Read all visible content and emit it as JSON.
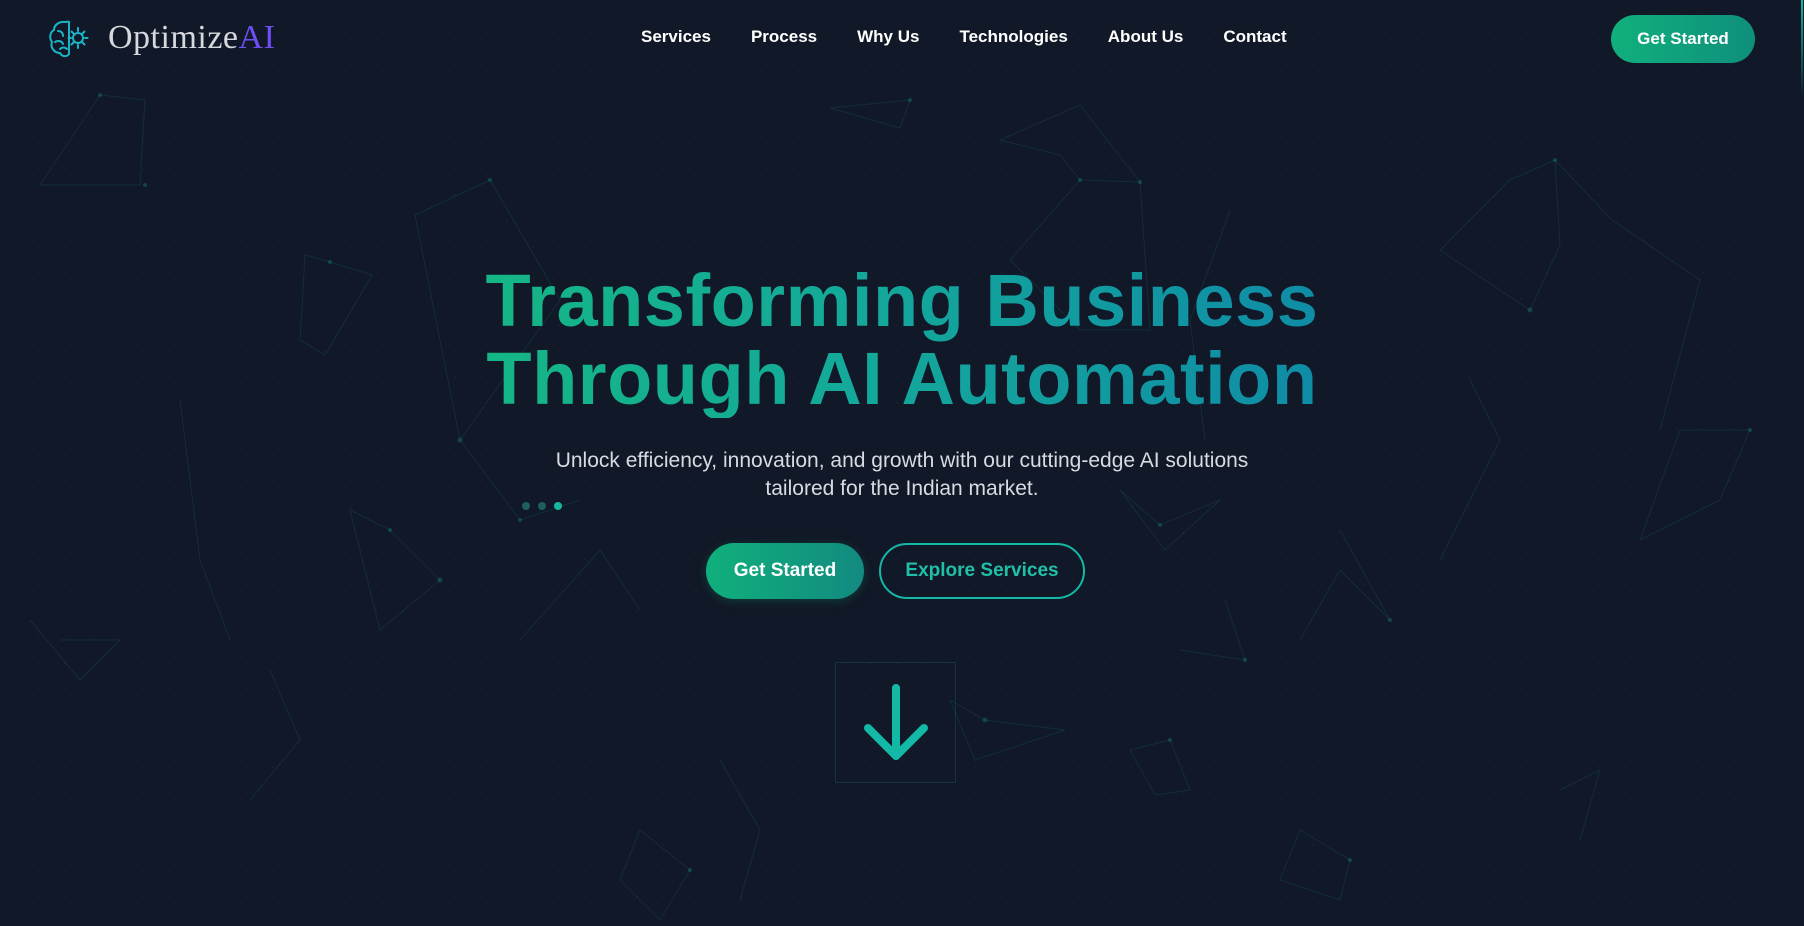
{
  "brand": {
    "name_main": "Optimize",
    "name_accent": "AI",
    "icon": "brain-gear-icon",
    "accent_color": "#6d4ef5"
  },
  "nav": {
    "items": [
      {
        "label": "Services"
      },
      {
        "label": "Process"
      },
      {
        "label": "Why Us"
      },
      {
        "label": "Technologies"
      },
      {
        "label": "About Us"
      },
      {
        "label": "Contact"
      }
    ],
    "cta_label": "Get Started"
  },
  "hero": {
    "title_line1": "Transforming Business",
    "title_line2": "Through AI Automation",
    "subtitle_line1": "Unlock efficiency, innovation, and growth with our cutting-edge AI solutions",
    "subtitle_line2": "tailored for the Indian market.",
    "slide_count": 3,
    "active_slide": 3,
    "primary_button": "Get Started",
    "secondary_button": "Explore Services",
    "scroll_icon": "arrow-down-icon"
  },
  "colors": {
    "background": "#111827",
    "primary_green": "#10b07c",
    "teal": "#14b8a6",
    "title_gradient_start": "#15b981",
    "title_gradient_end": "#0e87a8"
  }
}
